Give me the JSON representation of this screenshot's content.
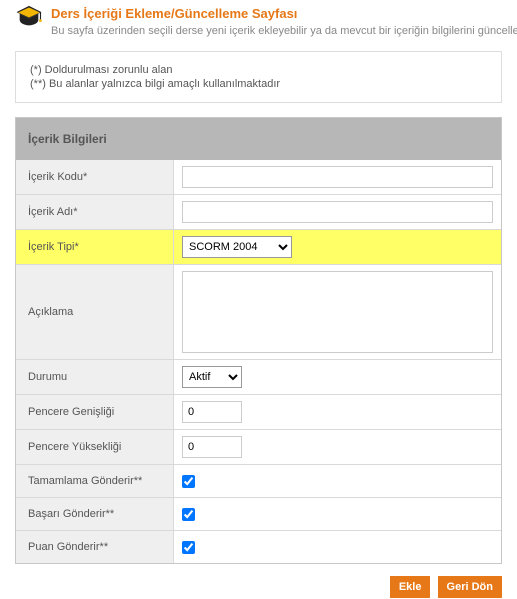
{
  "header": {
    "title": "Ders İçeriği Ekleme/Güncelleme Sayfası",
    "subtitle": "Bu sayfa üzerinden seçili derse yeni içerik ekleyebilir ya da mevcut bir içeriğin bilgilerini güncelleye"
  },
  "notes": {
    "line1": "(*) Doldurulması zorunlu alan",
    "line2": "(**) Bu alanlar yalnızca bilgi amaçlı kullanılmaktadır"
  },
  "section_title": "İçerik Bilgileri",
  "labels": {
    "code": "İçerik Kodu*",
    "name": "İçerik Adı*",
    "type": "İçerik Tipi*",
    "desc": "Açıklama",
    "status": "Durumu",
    "win_w": "Pencere Genişliği",
    "win_h": "Pencere Yüksekliği",
    "complete": "Tamamlama Gönderir**",
    "success": "Başarı Gönderir**",
    "score": "Puan Gönderir**"
  },
  "values": {
    "code": "",
    "name": "",
    "type_selected": "SCORM 2004",
    "desc": "",
    "status_selected": "Aktif",
    "win_w": "0",
    "win_h": "0",
    "complete": true,
    "success": true,
    "score": true
  },
  "buttons": {
    "add": "Ekle",
    "back": "Geri Dön"
  }
}
